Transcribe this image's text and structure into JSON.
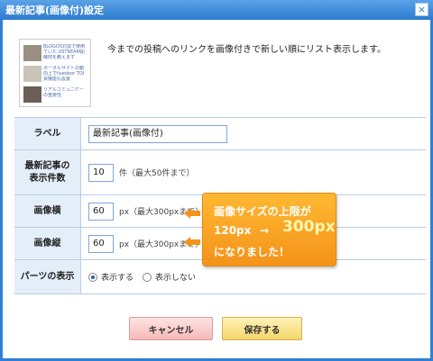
{
  "window": {
    "title": "最新記事(画像付)設定",
    "close_glyph": "×"
  },
  "thumbnail": {
    "lines": [
      "BLOGOS対談で使用",
      "ていた USTREAM配",
      "機材を教えます",
      "ポータルサイトの動",
      "向上でlivedoor TOI",
      "貢機能も設置",
      "リアルコミュニケー",
      "の重要性"
    ]
  },
  "intro_text": "今までの投稿へのリンクを画像付きで新しい順にリスト表示します。",
  "form": {
    "label_row": {
      "label": "ラベル",
      "value": "最新記事(画像付)"
    },
    "count_row": {
      "label_line1": "最新記事の",
      "label_line2": "表示件数",
      "value": "10",
      "note": "件（最大50件まで）"
    },
    "width_row": {
      "label": "画像横",
      "value": "60",
      "note": "px（最大300pxまで）"
    },
    "height_row": {
      "label": "画像縦",
      "value": "60",
      "note": "px（最大300pxまで）"
    },
    "display_row": {
      "label": "パーツの表示",
      "options": [
        "表示する",
        "表示しない"
      ],
      "selected": "表示する"
    }
  },
  "callout": {
    "line1": "画像サイズの上限が",
    "old_value": "120px",
    "arrow": "→",
    "new_value": "300px",
    "line3": "になりました！",
    "color": "#f4931a"
  },
  "buttons": {
    "cancel": "キャンセル",
    "save": "保存する"
  },
  "colors": {
    "titlebar": "#2c7ad0",
    "label_bg": "#e4eef9",
    "cancel": "#f7b9b9",
    "save": "#f6d56a"
  }
}
